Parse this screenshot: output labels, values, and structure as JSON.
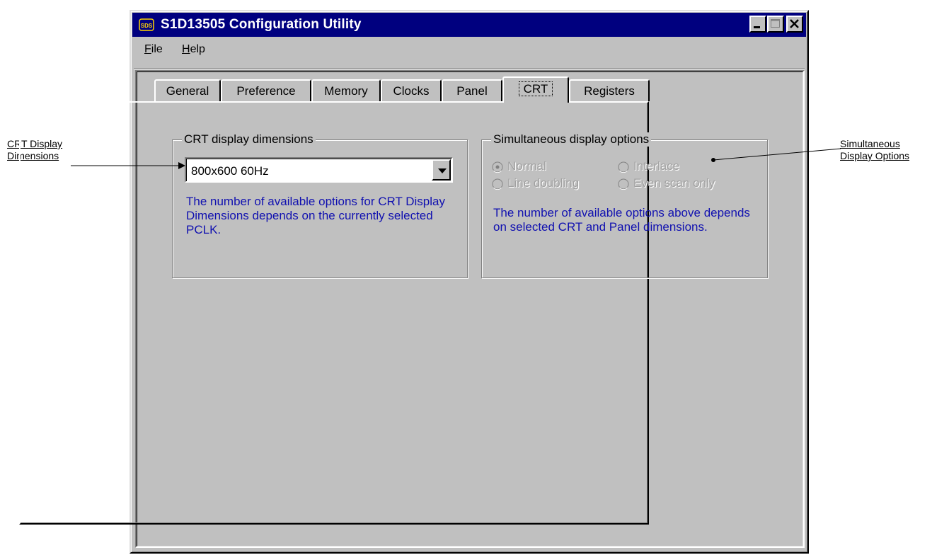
{
  "window": {
    "title": "S1D13505 Configuration Utility",
    "icon_text": "SDS",
    "controls": [
      "minimize",
      "maximize",
      "close"
    ]
  },
  "menubar": {
    "items": [
      {
        "label_prefix": "",
        "label_ul": "F",
        "label_rest": "ile"
      },
      {
        "label_prefix": "",
        "label_ul": "H",
        "label_rest": "elp"
      }
    ]
  },
  "tabs": [
    {
      "label": "General",
      "active": false
    },
    {
      "label": "Preference",
      "active": false
    },
    {
      "label": "Memory",
      "active": false
    },
    {
      "label": "Clocks",
      "active": false
    },
    {
      "label": "Panel",
      "active": false
    },
    {
      "label": "CRT",
      "active": true
    },
    {
      "label": "Registers",
      "active": false
    }
  ],
  "crt_group": {
    "legend": "CRT display dimensions",
    "selected": "800x600 60Hz",
    "note": "The number of available options for CRT Display Dimensions depends on the currently selected PCLK."
  },
  "sim_group": {
    "legend": "Simultaneous display options",
    "options": {
      "normal": {
        "label": "Normal",
        "checked": true,
        "enabled": false
      },
      "interlace": {
        "label": "Interlace",
        "checked": false,
        "enabled": false
      },
      "line_doubling": {
        "label": "Line doubling",
        "checked": false,
        "enabled": false
      },
      "even_scan": {
        "label": "Even scan only",
        "checked": false,
        "enabled": false
      }
    },
    "note": "The number of available options above depends on selected CRT and Panel dimensions."
  },
  "annotations": {
    "left_line1": "CRT Display",
    "left_line2": "Dimensions",
    "right_line1": "Simultaneous",
    "right_line2": "Display Options"
  },
  "colors": {
    "titlebar": "#00007f",
    "face": "#c0c0c0",
    "note_text": "#1010b0",
    "disabled_text": "#a0a0a0"
  }
}
